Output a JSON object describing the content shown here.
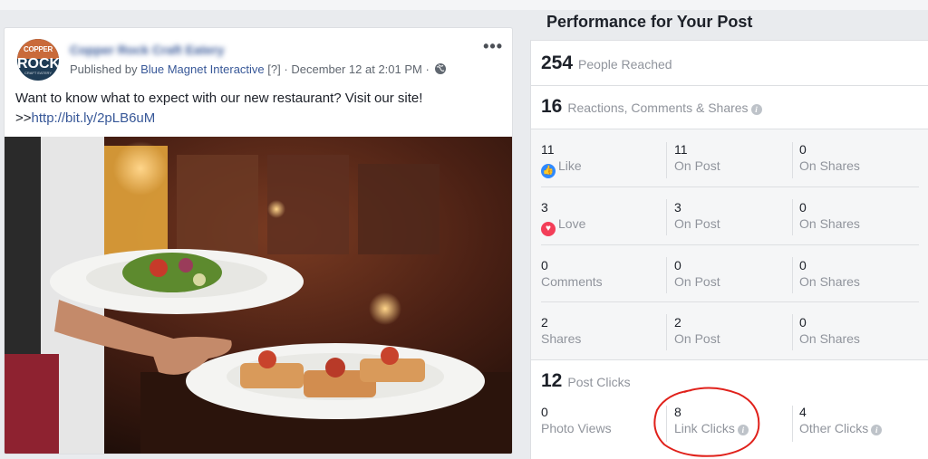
{
  "post": {
    "logo_line1": "COPPER",
    "logo_line2": "ROCK",
    "logo_line3": "CRAFT EATERY",
    "page_name": "Copper Rock Craft Eatery",
    "published_by_prefix": "Published by",
    "publisher": "Blue Magnet Interactive",
    "help_mark": "[?]",
    "sep1": "·",
    "date": "December 12 at 2:01 PM",
    "sep2": "·",
    "text_line1": "Want to know what to expect with our new restaurant? Visit our site!",
    "text_prefix": ">>",
    "link": "http://bit.ly/2pLB6uM",
    "more": "•••",
    "globe_icon": "globe-icon"
  },
  "performance": {
    "title": "Performance for Your Post",
    "reached_count": "254",
    "reached_label": "People Reached",
    "rcs_count": "16",
    "rcs_label": "Reactions, Comments & Shares",
    "reactions": [
      {
        "count": "11",
        "label": "Like",
        "icon": "like-icon",
        "on_post": "11",
        "on_post_label": "On Post",
        "on_shares": "0",
        "on_shares_label": "On Shares"
      },
      {
        "count": "3",
        "label": "Love",
        "icon": "love-icon",
        "on_post": "3",
        "on_post_label": "On Post",
        "on_shares": "0",
        "on_shares_label": "On Shares"
      },
      {
        "count": "0",
        "label": "Comments",
        "on_post": "0",
        "on_post_label": "On Post",
        "on_shares": "0",
        "on_shares_label": "On Shares"
      },
      {
        "count": "2",
        "label": "Shares",
        "on_post": "2",
        "on_post_label": "On Post",
        "on_shares": "0",
        "on_shares_label": "On Shares"
      }
    ],
    "clicks_count": "12",
    "clicks_label": "Post Clicks",
    "clicks": [
      {
        "count": "0",
        "label": "Photo Views"
      },
      {
        "count": "8",
        "label": "Link Clicks"
      },
      {
        "count": "4",
        "label": "Other Clicks"
      }
    ],
    "info_glyph": "i",
    "like_glyph": "👍",
    "love_glyph": "♥"
  },
  "colors": {
    "accent_link": "#385898",
    "annotation": "#e0211b",
    "like": "#2e89ff",
    "love": "#f33e58"
  }
}
